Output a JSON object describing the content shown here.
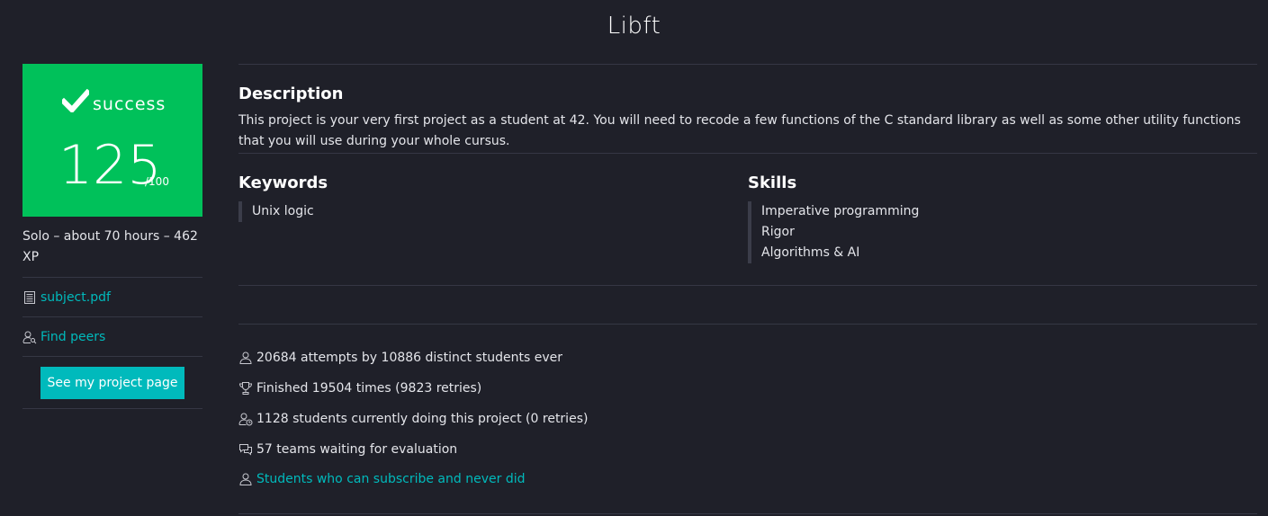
{
  "title": "Libft",
  "badge": {
    "status": "success",
    "score": "125",
    "max": "/100",
    "color": "#00c15a"
  },
  "meta": "Solo – about 70 hours – 462 XP",
  "links": {
    "subject": "subject.pdf",
    "find_peers": "Find peers"
  },
  "button_label": "See my project page",
  "description": {
    "heading": "Description",
    "text": "This project is your very first project as a student at 42. You will need to recode a few functions of the C standard library as well as some other utility functions that you will use during your whole cursus."
  },
  "keywords": {
    "heading": "Keywords",
    "items": [
      "Unix logic"
    ]
  },
  "skills": {
    "heading": "Skills",
    "items": [
      "Imperative programming",
      "Rigor",
      "Algorithms & AI"
    ]
  },
  "stats": {
    "attempts": "20684 attempts by 10886 distinct students ever",
    "finished": "Finished 19504 times (9823 retries)",
    "current": "1128 students currently doing this project (0 retries)",
    "waiting": "57 teams waiting for evaluation",
    "never_did": "Students who can subscribe and never did"
  },
  "icons": {
    "check": "checkmark-icon",
    "document": "document-icon",
    "peers": "user-search-icon",
    "user": "user-icon",
    "trophy": "trophy-icon",
    "user_clock": "user-clock-icon",
    "chat": "chat-bubbles-icon"
  },
  "colors": {
    "background": "#1f2029",
    "accent": "#00babc",
    "success": "#00c15a"
  }
}
